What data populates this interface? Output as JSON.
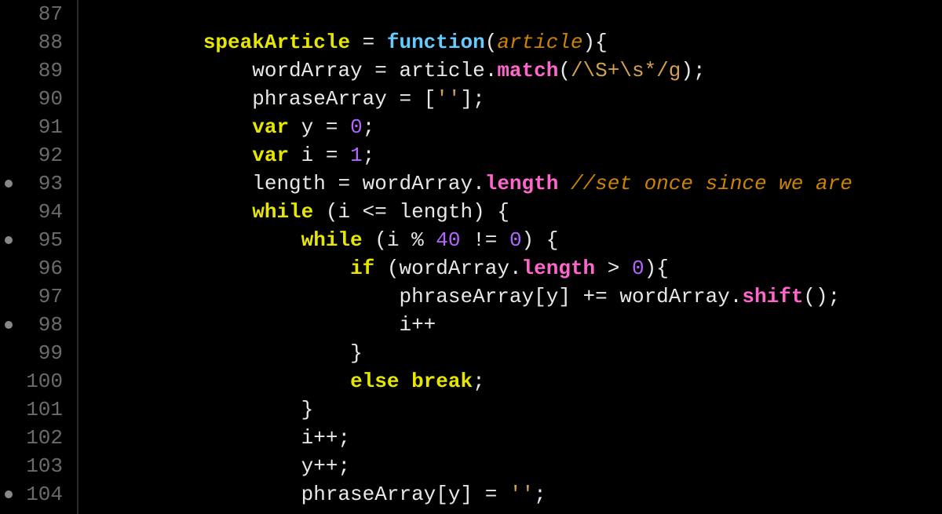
{
  "editor": {
    "lines": [
      {
        "num": "87",
        "bp": false,
        "tokens": []
      },
      {
        "num": "88",
        "bp": false,
        "tokens": [
          {
            "t": "indent",
            "v": "        "
          },
          {
            "t": "def",
            "v": "speakArticle"
          },
          {
            "t": "op",
            "v": " = "
          },
          {
            "t": "fn",
            "v": "function"
          },
          {
            "t": "punc",
            "v": "("
          },
          {
            "t": "param",
            "v": "article"
          },
          {
            "t": "punc",
            "v": "){"
          }
        ]
      },
      {
        "num": "89",
        "bp": false,
        "tokens": [
          {
            "t": "indent",
            "v": "            "
          },
          {
            "t": "id",
            "v": "wordArray"
          },
          {
            "t": "op",
            "v": " = "
          },
          {
            "t": "id",
            "v": "article"
          },
          {
            "t": "punc",
            "v": "."
          },
          {
            "t": "prop",
            "v": "match"
          },
          {
            "t": "punc",
            "v": "("
          },
          {
            "t": "re",
            "v": "/\\S+\\s*/g"
          },
          {
            "t": "punc",
            "v": ");"
          }
        ]
      },
      {
        "num": "90",
        "bp": false,
        "tokens": [
          {
            "t": "indent",
            "v": "            "
          },
          {
            "t": "id",
            "v": "phraseArray"
          },
          {
            "t": "op",
            "v": " = "
          },
          {
            "t": "punc",
            "v": "["
          },
          {
            "t": "str",
            "v": "''"
          },
          {
            "t": "punc",
            "v": "];"
          }
        ]
      },
      {
        "num": "91",
        "bp": false,
        "tokens": [
          {
            "t": "indent",
            "v": "            "
          },
          {
            "t": "kw",
            "v": "var"
          },
          {
            "t": "id",
            "v": " y"
          },
          {
            "t": "op",
            "v": " = "
          },
          {
            "t": "num",
            "v": "0"
          },
          {
            "t": "punc",
            "v": ";"
          }
        ]
      },
      {
        "num": "92",
        "bp": false,
        "tokens": [
          {
            "t": "indent",
            "v": "            "
          },
          {
            "t": "kw",
            "v": "var"
          },
          {
            "t": "id",
            "v": " i"
          },
          {
            "t": "op",
            "v": " = "
          },
          {
            "t": "num",
            "v": "1"
          },
          {
            "t": "punc",
            "v": ";"
          }
        ]
      },
      {
        "num": "93",
        "bp": true,
        "tokens": [
          {
            "t": "indent",
            "v": "            "
          },
          {
            "t": "id",
            "v": "length"
          },
          {
            "t": "op",
            "v": " = "
          },
          {
            "t": "id",
            "v": "wordArray"
          },
          {
            "t": "punc",
            "v": "."
          },
          {
            "t": "prop",
            "v": "length"
          },
          {
            "t": "id",
            "v": " "
          },
          {
            "t": "cmt",
            "v": "//set once since we are"
          }
        ]
      },
      {
        "num": "94",
        "bp": false,
        "tokens": [
          {
            "t": "indent",
            "v": "            "
          },
          {
            "t": "kw",
            "v": "while"
          },
          {
            "t": "punc",
            "v": " ("
          },
          {
            "t": "id",
            "v": "i"
          },
          {
            "t": "op",
            "v": " <= "
          },
          {
            "t": "id",
            "v": "length"
          },
          {
            "t": "punc",
            "v": ") {"
          }
        ]
      },
      {
        "num": "95",
        "bp": true,
        "tokens": [
          {
            "t": "indent",
            "v": "                "
          },
          {
            "t": "kw",
            "v": "while"
          },
          {
            "t": "punc",
            "v": " ("
          },
          {
            "t": "id",
            "v": "i"
          },
          {
            "t": "op",
            "v": " % "
          },
          {
            "t": "num",
            "v": "40"
          },
          {
            "t": "op",
            "v": " != "
          },
          {
            "t": "num",
            "v": "0"
          },
          {
            "t": "punc",
            "v": ") {"
          }
        ]
      },
      {
        "num": "96",
        "bp": false,
        "tokens": [
          {
            "t": "indent",
            "v": "                    "
          },
          {
            "t": "kw",
            "v": "if"
          },
          {
            "t": "punc",
            "v": " ("
          },
          {
            "t": "id",
            "v": "wordArray"
          },
          {
            "t": "punc",
            "v": "."
          },
          {
            "t": "prop",
            "v": "length"
          },
          {
            "t": "op",
            "v": " > "
          },
          {
            "t": "num",
            "v": "0"
          },
          {
            "t": "punc",
            "v": "){"
          }
        ]
      },
      {
        "num": "97",
        "bp": false,
        "tokens": [
          {
            "t": "indent",
            "v": "                        "
          },
          {
            "t": "id",
            "v": "phraseArray"
          },
          {
            "t": "punc",
            "v": "["
          },
          {
            "t": "id",
            "v": "y"
          },
          {
            "t": "punc",
            "v": "]"
          },
          {
            "t": "op",
            "v": " += "
          },
          {
            "t": "id",
            "v": "wordArray"
          },
          {
            "t": "punc",
            "v": "."
          },
          {
            "t": "prop",
            "v": "shift"
          },
          {
            "t": "punc",
            "v": "();"
          }
        ]
      },
      {
        "num": "98",
        "bp": true,
        "tokens": [
          {
            "t": "indent",
            "v": "                        "
          },
          {
            "t": "id",
            "v": "i"
          },
          {
            "t": "op",
            "v": "++"
          }
        ]
      },
      {
        "num": "99",
        "bp": false,
        "tokens": [
          {
            "t": "indent",
            "v": "                    "
          },
          {
            "t": "punc",
            "v": "}"
          }
        ]
      },
      {
        "num": "100",
        "bp": false,
        "tokens": [
          {
            "t": "indent",
            "v": "                    "
          },
          {
            "t": "kw",
            "v": "else"
          },
          {
            "t": "id",
            "v": " "
          },
          {
            "t": "kw",
            "v": "break"
          },
          {
            "t": "punc",
            "v": ";"
          }
        ]
      },
      {
        "num": "101",
        "bp": false,
        "tokens": [
          {
            "t": "indent",
            "v": "                "
          },
          {
            "t": "punc",
            "v": "}"
          }
        ]
      },
      {
        "num": "102",
        "bp": false,
        "tokens": [
          {
            "t": "indent",
            "v": "                "
          },
          {
            "t": "id",
            "v": "i"
          },
          {
            "t": "op",
            "v": "++"
          },
          {
            "t": "punc",
            "v": ";"
          }
        ]
      },
      {
        "num": "103",
        "bp": false,
        "tokens": [
          {
            "t": "indent",
            "v": "                "
          },
          {
            "t": "id",
            "v": "y"
          },
          {
            "t": "op",
            "v": "++"
          },
          {
            "t": "punc",
            "v": ";"
          }
        ]
      },
      {
        "num": "104",
        "bp": true,
        "tokens": [
          {
            "t": "indent",
            "v": "                "
          },
          {
            "t": "id",
            "v": "phraseArray"
          },
          {
            "t": "punc",
            "v": "["
          },
          {
            "t": "id",
            "v": "y"
          },
          {
            "t": "punc",
            "v": "]"
          },
          {
            "t": "op",
            "v": " = "
          },
          {
            "t": "str",
            "v": "''"
          },
          {
            "t": "punc",
            "v": ";"
          }
        ]
      }
    ]
  }
}
